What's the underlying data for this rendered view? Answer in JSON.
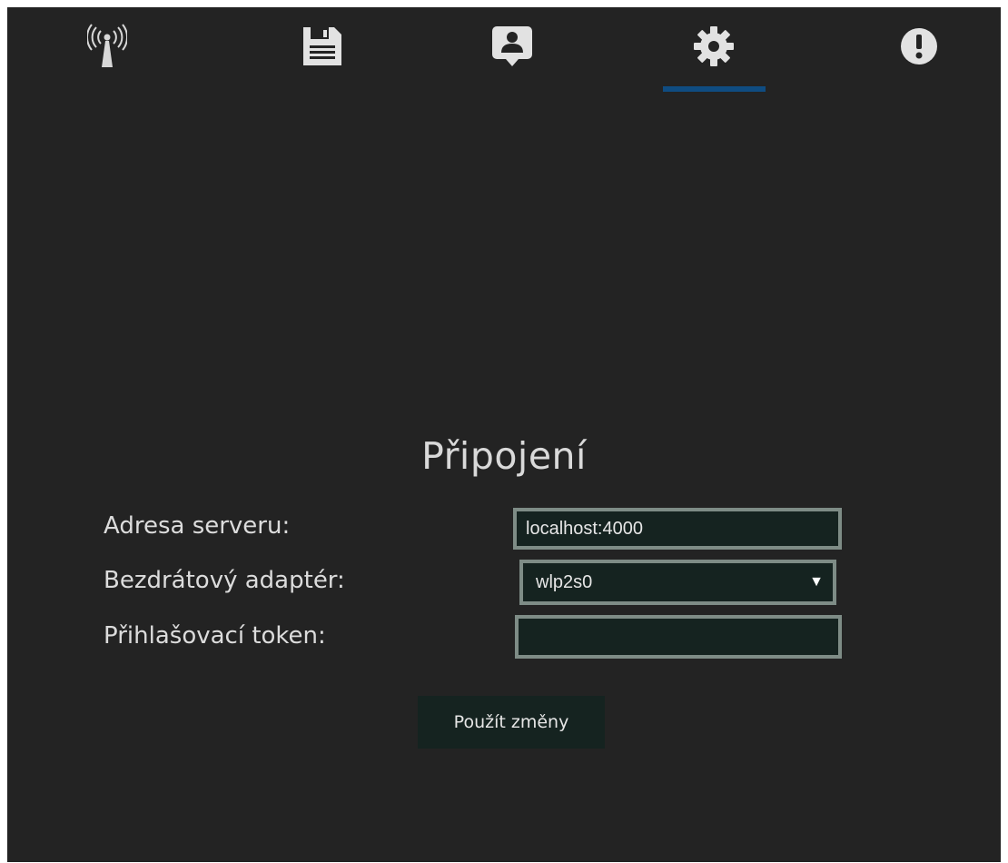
{
  "nav": {
    "tabs": [
      {
        "icon": "wireless-tower-icon",
        "active": false
      },
      {
        "icon": "floppy-disk-icon",
        "active": false
      },
      {
        "icon": "contact-card-icon",
        "active": false
      },
      {
        "icon": "gear-icon",
        "active": true
      },
      {
        "icon": "exclamation-circle-icon",
        "active": false
      }
    ],
    "indicator_color": "#0f4c81"
  },
  "settings": {
    "title": "Připojení",
    "server_label": "Adresa serveru:",
    "server_value": "localhost:4000",
    "adapter_label": "Bezdrátový adaptér:",
    "adapter_value": "wlp2s0",
    "token_label": "Přihlašovací token:",
    "token_value": "",
    "apply_label": "Použít změny"
  },
  "colors": {
    "background": "#232323",
    "field_background": "#152320",
    "field_border": "#7e8c86",
    "text": "#dcdcdc"
  }
}
